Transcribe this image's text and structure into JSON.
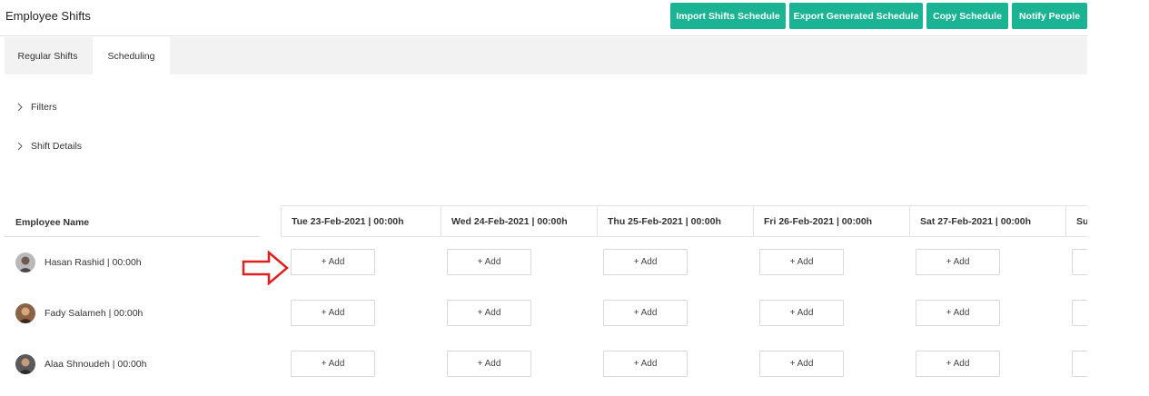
{
  "header": {
    "title": "Employee Shifts",
    "buttons": {
      "import": "Import Shifts Schedule",
      "export": "Export Generated Schedule",
      "copy": "Copy Schedule",
      "notify": "Notify People"
    }
  },
  "tabs": {
    "regular": "Regular Shifts",
    "scheduling": "Scheduling",
    "active": "Scheduling"
  },
  "sections": {
    "filters": "Filters",
    "shift_details": "Shift Details"
  },
  "schedule": {
    "employee_col_header": "Employee Name",
    "days": [
      "Tue 23-Feb-2021 | 00:00h",
      "Wed 24-Feb-2021 | 00:00h",
      "Thu 25-Feb-2021 | 00:00h",
      "Fri 26-Feb-2021 | 00:00h",
      "Sat 27-Feb-2021 | 00:00h",
      "Sun"
    ],
    "add_label": "+ Add",
    "employees": [
      {
        "name": "Hasan Rashid | 00:00h"
      },
      {
        "name": "Fady Salameh | 00:00h"
      },
      {
        "name": "Alaa Shnoudeh | 00:00h"
      }
    ]
  },
  "colors": {
    "accent": "#1ab394",
    "annotation_arrow": "#e02020"
  }
}
